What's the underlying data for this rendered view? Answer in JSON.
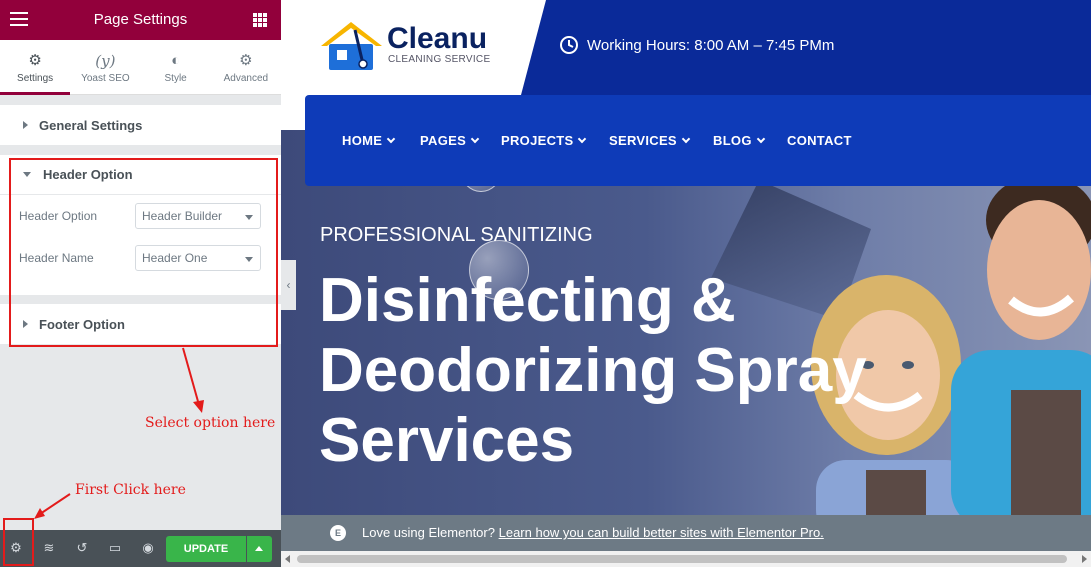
{
  "panel": {
    "title": "Page Settings",
    "tabs": [
      {
        "label": "Settings",
        "icon": "gear-icon"
      },
      {
        "label": "Yoast SEO",
        "icon": "yoast-icon"
      },
      {
        "label": "Style",
        "icon": "half-circle-icon"
      },
      {
        "label": "Advanced",
        "icon": "gear-icon"
      }
    ],
    "sections": {
      "general": "General Settings",
      "header": "Header Option",
      "footer": "Footer Option"
    },
    "controls": {
      "header_option": {
        "label": "Header Option",
        "value": "Header Builder"
      },
      "header_name": {
        "label": "Header Name",
        "value": "Header One"
      }
    },
    "update_label": "UPDATE"
  },
  "annotations": {
    "select_option": "Select option here",
    "first_click": "First Click here"
  },
  "site": {
    "logo": {
      "name": "Cleanu",
      "tagline": "CLEANING SERVICE"
    },
    "hours": "Working Hours: 8:00 AM – 7:45 PMm",
    "nav": [
      "HOME",
      "PAGES",
      "PROJECTS",
      "SERVICES",
      "BLOG",
      "CONTACT"
    ],
    "hero_subtitle": "PROFESSIONAL SANITIZING",
    "hero_title": "Disinfecting & Deodorizing Spray Services",
    "promo_text": "Love using Elementor?",
    "promo_link": "Learn how you can build better sites with Elementor Pro."
  },
  "colors": {
    "elementor_brand": "#92003b",
    "update_green": "#39b54a",
    "annotation_red": "#e31b1b",
    "site_blue": "#0a2a99"
  }
}
